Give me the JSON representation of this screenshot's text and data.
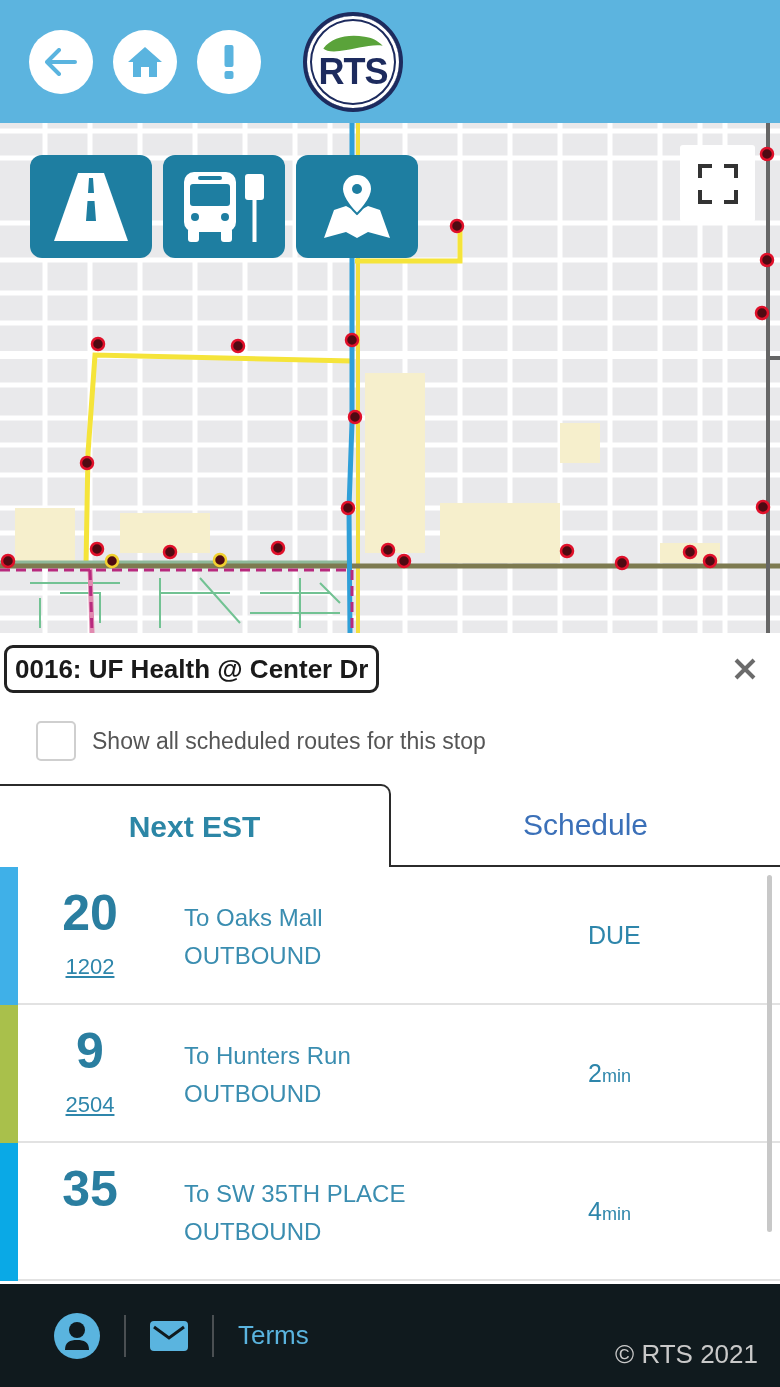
{
  "header": {
    "buttons": [
      {
        "kind": "back"
      },
      {
        "kind": "home"
      },
      {
        "kind": "alert"
      }
    ],
    "logo": {
      "text": "RTS"
    }
  },
  "map": {
    "tools": [
      {
        "kind": "routes"
      },
      {
        "kind": "stops"
      },
      {
        "kind": "places"
      }
    ]
  },
  "stop": {
    "title": "0016: UF Health @ Center Dr"
  },
  "show_all": {
    "label": "Show all scheduled routes for this stop",
    "checked": false
  },
  "tabs": [
    {
      "label": "Next EST",
      "selected": true
    },
    {
      "label": "Schedule",
      "selected": false
    }
  ],
  "arrivals": [
    {
      "route": "20",
      "vehicle": "1202",
      "destination": "To Oaks Mall",
      "direction": "OUTBOUND",
      "time": "DUE",
      "color": "#3fb0e8"
    },
    {
      "route": "9",
      "vehicle": "2504",
      "destination": "To Hunters Run",
      "direction": "OUTBOUND",
      "time": "2",
      "unit": "min",
      "color": "#a9c04b"
    },
    {
      "route": "35",
      "destination": "To SW 35TH PLACE",
      "direction": "OUTBOUND",
      "time": "4",
      "unit": "min",
      "color": "#0aa9e6"
    }
  ],
  "footer": {
    "icons": [
      {
        "kind": "account"
      },
      {
        "kind": "mail"
      }
    ],
    "link": "Terms",
    "copyright": "© RTS 2021"
  }
}
